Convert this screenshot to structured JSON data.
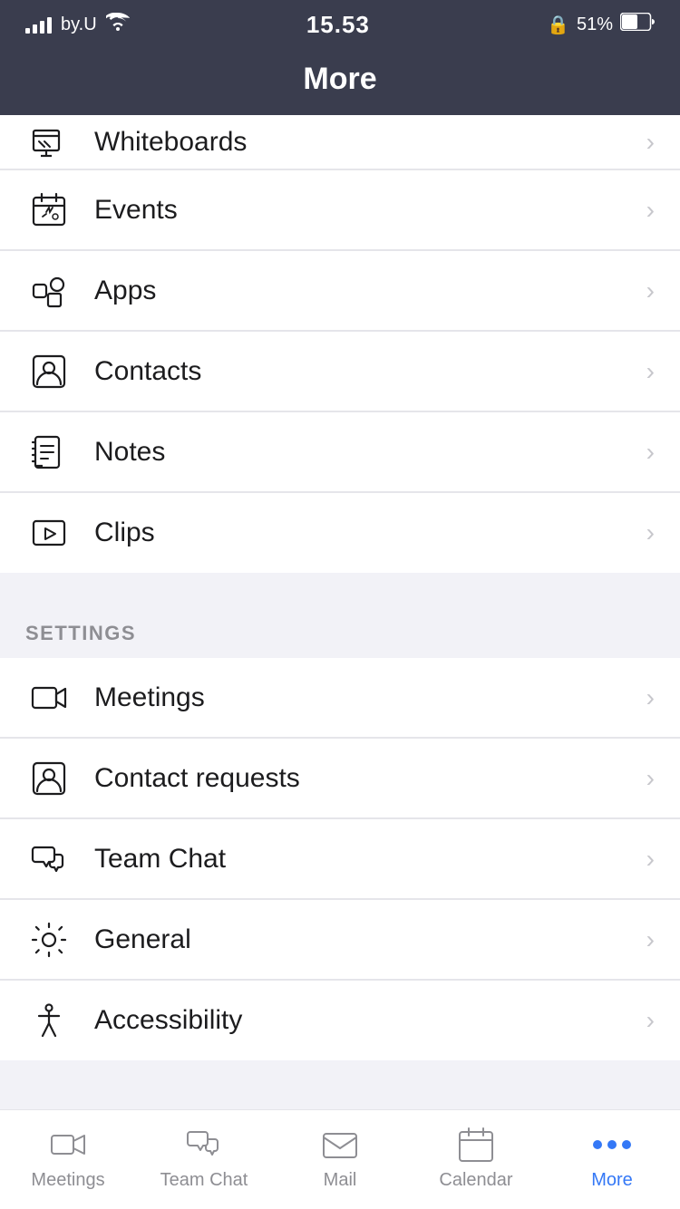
{
  "statusBar": {
    "carrier": "by.U",
    "time": "15.53",
    "battery": "51%",
    "lock_icon": "🔒"
  },
  "header": {
    "title": "More"
  },
  "menuItems": {
    "top": [
      {
        "id": "whiteboards",
        "label": "Whiteboards",
        "icon": "whiteboard"
      },
      {
        "id": "events",
        "label": "Events",
        "icon": "events"
      },
      {
        "id": "apps",
        "label": "Apps",
        "icon": "apps"
      },
      {
        "id": "contacts",
        "label": "Contacts",
        "icon": "contacts"
      },
      {
        "id": "notes",
        "label": "Notes",
        "icon": "notes"
      },
      {
        "id": "clips",
        "label": "Clips",
        "icon": "clips"
      }
    ],
    "settingsLabel": "SETTINGS",
    "settings": [
      {
        "id": "meetings",
        "label": "Meetings",
        "icon": "meetings"
      },
      {
        "id": "contact-requests",
        "label": "Contact requests",
        "icon": "contact-requests"
      },
      {
        "id": "team-chat",
        "label": "Team Chat",
        "icon": "team-chat"
      },
      {
        "id": "general",
        "label": "General",
        "icon": "general"
      },
      {
        "id": "accessibility",
        "label": "Accessibility",
        "icon": "accessibility"
      }
    ]
  },
  "tabBar": {
    "items": [
      {
        "id": "meetings",
        "label": "Meetings",
        "active": false
      },
      {
        "id": "team-chat",
        "label": "Team Chat",
        "active": false
      },
      {
        "id": "mail",
        "label": "Mail",
        "active": false
      },
      {
        "id": "calendar",
        "label": "Calendar",
        "active": false
      },
      {
        "id": "more",
        "label": "More",
        "active": true
      }
    ]
  }
}
